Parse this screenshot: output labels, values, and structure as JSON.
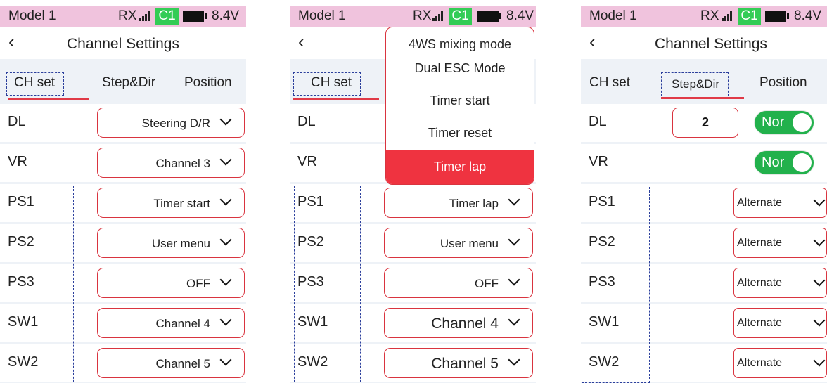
{
  "status": {
    "model": "Model 1",
    "rx": "RX",
    "channel_badge": "C1",
    "voltage": "8.4V"
  },
  "nav": {
    "back_icon": "chevron-left-icon",
    "title": "Channel Settings"
  },
  "tabs": {
    "ch_set": "CH set",
    "step_dir": "Step&Dir",
    "position": "Position"
  },
  "screen1": {
    "rows": [
      {
        "label": "DL",
        "value": "Steering D/R"
      },
      {
        "label": "VR",
        "value": "Channel 3"
      },
      {
        "label": "PS1",
        "value": "Timer start"
      },
      {
        "label": "PS2",
        "value": "User menu"
      },
      {
        "label": "PS3",
        "value": "OFF"
      },
      {
        "label": "SW1",
        "value": "Channel 4"
      },
      {
        "label": "SW2",
        "value": "Channel 5"
      }
    ]
  },
  "screen2": {
    "dropdown": [
      "4WS mixing mode",
      "Dual ESC Mode",
      "Timer start",
      "Timer reset",
      "Timer lap"
    ],
    "dropdown_selected": "Timer lap",
    "rows": [
      {
        "label": "DL",
        "value": ""
      },
      {
        "label": "VR",
        "value": ""
      },
      {
        "label": "PS1",
        "value": "Timer lap"
      },
      {
        "label": "PS2",
        "value": "User menu"
      },
      {
        "label": "PS3",
        "value": "OFF"
      },
      {
        "label": "SW1",
        "value": "Channel 4"
      },
      {
        "label": "SW2",
        "value": "Channel 5"
      }
    ]
  },
  "screen3": {
    "dl_step": "2",
    "toggle_label": "Nor",
    "rows": [
      {
        "label": "DL"
      },
      {
        "label": "VR"
      },
      {
        "label": "PS1",
        "value": "Alternate"
      },
      {
        "label": "PS2",
        "value": "Alternate"
      },
      {
        "label": "PS3",
        "value": "Alternate"
      },
      {
        "label": "SW1",
        "value": "Alternate"
      },
      {
        "label": "SW2",
        "value": "Alternate"
      }
    ]
  },
  "colors": {
    "accent": "#d9343f",
    "highlight": "#ef3340",
    "toggle_on": "#22b14c",
    "status_bar": "#f0c3dd"
  }
}
